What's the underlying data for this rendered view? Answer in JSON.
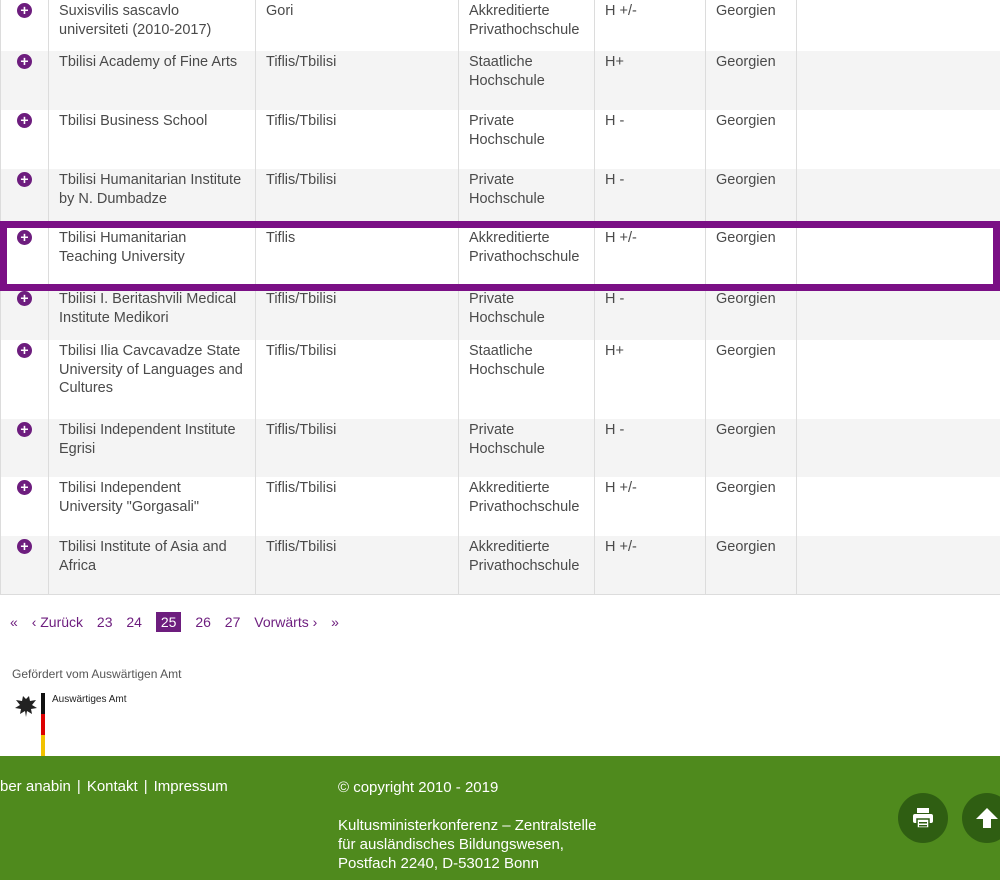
{
  "table": {
    "rows": [
      {
        "name": "Suxisvilis sascavlo universiteti (2010-2017)",
        "city": "Gori",
        "type": "Akkreditierte Privathochschule",
        "status": "H +/-",
        "country": "Georgien"
      },
      {
        "name": "Tbilisi Academy of Fine Arts",
        "city": "Tiflis/Tbilisi",
        "type": "Staatliche Hochschule",
        "status": "H+",
        "country": "Georgien"
      },
      {
        "name": "Tbilisi Business School",
        "city": "Tiflis/Tbilisi",
        "type": "Private Hochschule",
        "status": "H -",
        "country": "Georgien"
      },
      {
        "name": "Tbilisi Humanitarian Institute by N. Dumbadze",
        "city": "Tiflis/Tbilisi",
        "type": "Private Hochschule",
        "status": "H -",
        "country": "Georgien"
      },
      {
        "name": "Tbilisi Humanitarian Teaching University",
        "city": "Tiflis",
        "type": "Akkreditierte Privathochschule",
        "status": "H +/-",
        "country": "Georgien"
      },
      {
        "name": "Tbilisi I. Beritashvili Medical Institute Medikori",
        "city": "Tiflis/Tbilisi",
        "type": "Private Hochschule",
        "status": "H -",
        "country": "Georgien"
      },
      {
        "name": "Tbilisi Ilia Cavcavadze State University of Languages and Cultures",
        "city": "Tiflis/Tbilisi",
        "type": "Staatliche Hochschule",
        "status": "H+",
        "country": "Georgien"
      },
      {
        "name": "Tbilisi Independent Institute Egrisi",
        "city": "Tiflis/Tbilisi",
        "type": "Private Hochschule",
        "status": "H -",
        "country": "Georgien"
      },
      {
        "name": "Tbilisi Independent University \"Gorgasali\"",
        "city": "Tiflis/Tbilisi",
        "type": "Akkreditierte Privathochschule",
        "status": "H +/-",
        "country": "Georgien"
      },
      {
        "name": "Tbilisi Institute of Asia and Africa",
        "city": "Tiflis/Tbilisi",
        "type": "Akkreditierte Privathochschule",
        "status": "H +/-",
        "country": "Georgien"
      }
    ],
    "expand_icon": "plus-circle-icon"
  },
  "pagination": {
    "first": "«",
    "prev": "‹ Zurück",
    "pages": [
      "23",
      "24",
      "25",
      "26",
      "27"
    ],
    "current": "25",
    "next": "Vorwärts ›",
    "last": "»"
  },
  "funding": {
    "text": "Gefördert vom Auswärtigen Amt",
    "logo_text": "Auswärtiges Amt"
  },
  "footer": {
    "link_about": "ber anabin",
    "sep": "|",
    "link_contact": "Kontakt",
    "link_imprint": "Impressum",
    "copyright": "© copyright 2010 - 2019",
    "address_1": "Kultusministerkonferenz – Zentralstelle",
    "address_2": "für ausländisches Bildungswesen,",
    "address_3": "Postfach 2240, D-53012 Bonn",
    "print_icon": "print-icon",
    "top_icon": "arrow-up-icon"
  },
  "colors": {
    "accent": "#6d1d7e",
    "highlight": "#7a0f85",
    "footer": "#4f8a1d"
  }
}
